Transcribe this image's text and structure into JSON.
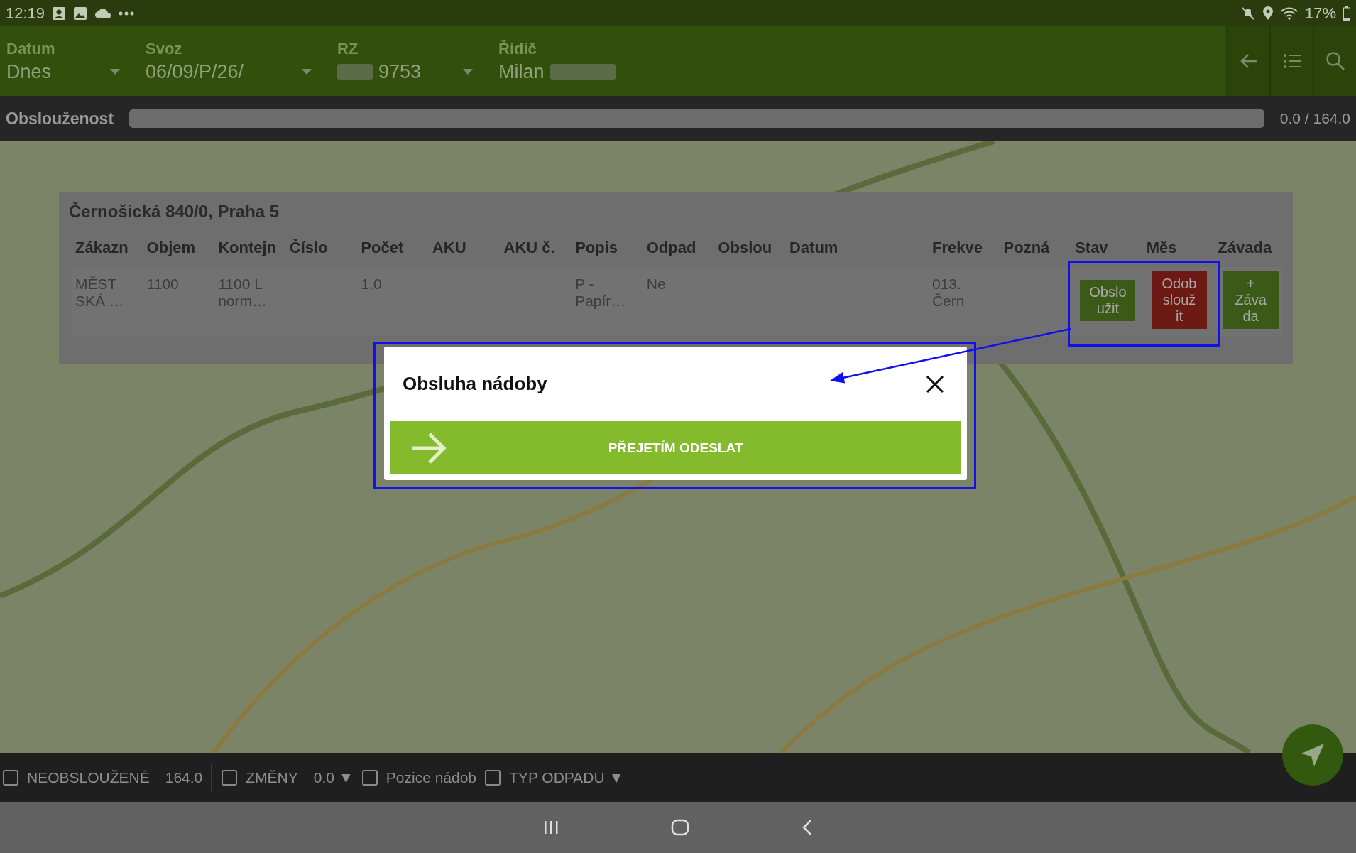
{
  "status_bar": {
    "time": "12:19",
    "battery": "17%"
  },
  "header": {
    "fields": [
      {
        "kind": "dropdown",
        "label": "Datum",
        "value": "Dnes"
      },
      {
        "kind": "dropdown",
        "label": "Svoz",
        "value": "06/09/P/26/"
      },
      {
        "kind": "redacted_dropdown",
        "label": "RZ",
        "value": "9753"
      },
      {
        "kind": "redacted_text",
        "label": "Řidič",
        "value": "Milan"
      }
    ]
  },
  "progress": {
    "label": "Obslouženost",
    "level": 0,
    "reading": "0.0 / 164.0"
  },
  "card": {
    "title": "Černošická 840/0, Praha 5",
    "columns": [
      "Zákazn",
      "Objem",
      "Kontejn",
      "Číslo",
      "Počet",
      "AKU",
      "AKU č.",
      "Popis",
      "Odpad",
      "Obslou",
      "Datum",
      "Frekve",
      "Pozná",
      "Stav",
      "Měs",
      "Závada"
    ],
    "rows": [
      {
        "cells": [
          {
            "kind": "text",
            "lines": [
              "MĚST",
              "SKÁ …"
            ]
          },
          {
            "kind": "text",
            "lines": [
              "1100"
            ]
          },
          {
            "kind": "text",
            "lines": [
              "1100 L",
              "norm…"
            ]
          },
          {
            "kind": "empty"
          },
          {
            "kind": "text",
            "lines": [
              "1.0"
            ]
          },
          {
            "kind": "empty"
          },
          {
            "kind": "empty"
          },
          {
            "kind": "text",
            "lines": [
              "P -",
              "Papír…"
            ]
          },
          {
            "kind": "text",
            "lines": [
              "Ne"
            ]
          },
          {
            "kind": "empty"
          },
          {
            "kind": "empty"
          },
          {
            "kind": "text",
            "lines": [
              "013.",
              "Čern"
            ]
          },
          {
            "kind": "empty"
          },
          {
            "kind": "button",
            "color": "#3c5a17",
            "lines": [
              "Obslo",
              "užit"
            ]
          },
          {
            "kind": "button",
            "color": "#6e1a14",
            "lines": [
              "Odob",
              "slouž",
              "it"
            ]
          },
          {
            "kind": "button",
            "color": "#3c5a17",
            "lines": [
              "+",
              "Záva",
              "da"
            ]
          }
        ]
      }
    ]
  },
  "dialog": {
    "title": "Obsluha nádoby",
    "action": "PŘEJETÍM ODESLAT"
  },
  "filters": [
    {
      "label": "NEOBSLOUŽENÉ",
      "checked": false,
      "value": "164.0"
    },
    {
      "label": "ZMĚNY",
      "checked": false,
      "value": "0.0",
      "caret": "▼"
    },
    {
      "label": "Pozice nádob",
      "checked": false
    },
    {
      "label": "TYP ODPADU",
      "checked": false,
      "caret": "▼"
    }
  ]
}
